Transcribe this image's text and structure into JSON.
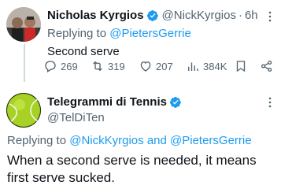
{
  "tweet1": {
    "author_name": "Nicholas Kyrgios",
    "handle": "@NickKyrgios",
    "separator": "·",
    "time": "6h",
    "reply_prefix": "Replying to",
    "reply_to": "@PietersGerrie",
    "text": "Second serve",
    "stats": {
      "replies": "269",
      "retweets": "319",
      "likes": "207",
      "views": "384K"
    }
  },
  "tweet2": {
    "author_name": "Telegrammi di Tennis",
    "handle": "@TelDiTen",
    "reply_prefix": "Replying to",
    "reply_to_1": "@NickKyrgios",
    "reply_and": "and",
    "reply_to_2": "@PietersGerrie",
    "text": "When a second serve is needed, it means first serve sucked."
  },
  "colors": {
    "link": "#1d9bf0",
    "muted": "#536471",
    "text": "#0f1419",
    "verified": "#1d9bf0"
  },
  "icons": [
    "verified-badge-icon",
    "more-icon",
    "reply-icon",
    "retweet-icon",
    "like-icon",
    "views-icon",
    "bookmark-icon",
    "share-icon"
  ]
}
